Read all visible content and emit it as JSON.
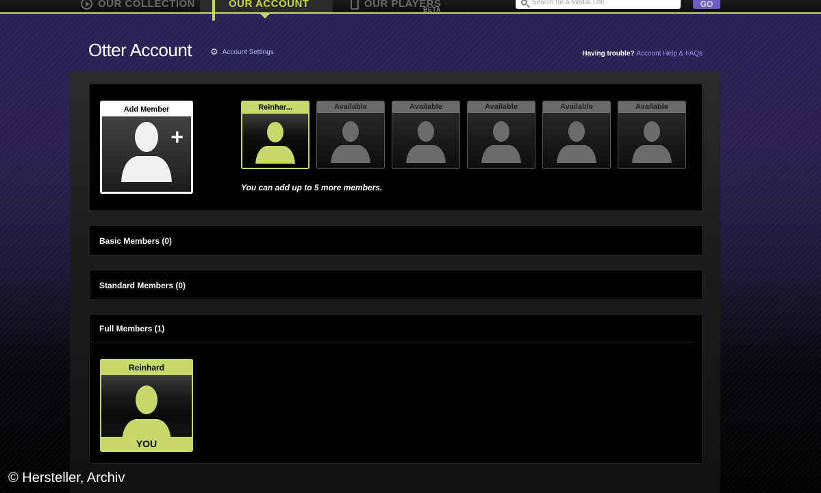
{
  "nav": {
    "tabs": [
      {
        "label": "OUR COLLECTION",
        "icon": "play-circle-icon"
      },
      {
        "label": "OUR ACCOUNT",
        "icon": "bars-icon",
        "active": true
      },
      {
        "label": "OUR PLAYERS",
        "icon": "phone-icon",
        "badge": "BETA"
      }
    ],
    "search_placeholder": "Search for a Media Title",
    "go_label": "GO"
  },
  "header": {
    "title": "Otter Account",
    "settings_label": "Account Settings",
    "help_prefix": "Having trouble?",
    "help_link": "Account Help & FAQs"
  },
  "members": {
    "add_label": "Add Member",
    "slots": [
      "Reinhar...",
      "Available",
      "Available",
      "Available",
      "Available",
      "Available"
    ],
    "note": "You can add up to 5 more members."
  },
  "sections": {
    "basic": "Basic Members (0)",
    "standard": "Standard Members (0)",
    "full": "Full Members (1)"
  },
  "full_member": {
    "name": "Reinhard",
    "you_label": "YOU"
  },
  "copyright": "© Hersteller, Archiv",
  "colors": {
    "accent": "#c8d86a",
    "link": "#9d97ff",
    "go_button": "#6f5cc0"
  }
}
